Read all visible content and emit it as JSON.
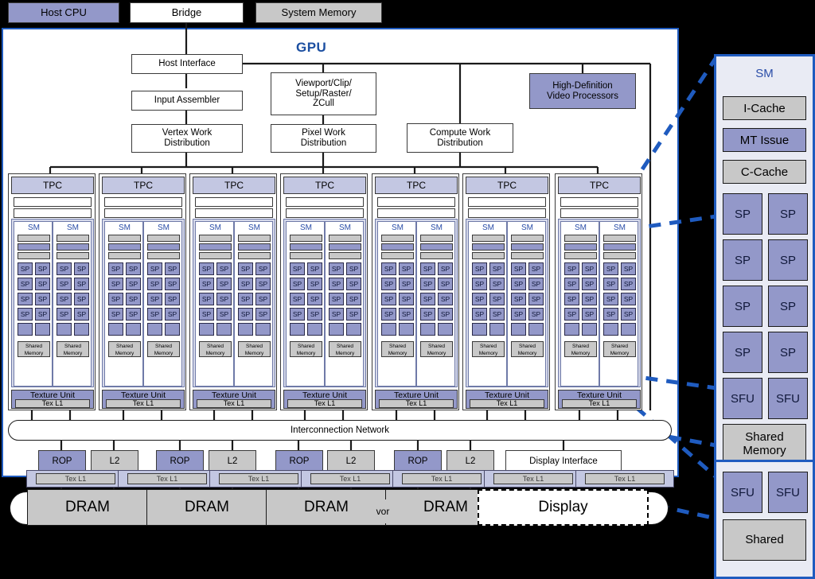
{
  "host": {
    "cpu": "Host CPU",
    "bridge": "Bridge",
    "system_memory": "System Memory"
  },
  "gpu": {
    "title": "GPU",
    "host_interface": "Host Interface",
    "input_assembler": "Input Assembler",
    "viewport_clip": "Viewport/Clip/\nSetup/Raster/\nZCull",
    "viewport_clip_lines": [
      "Viewport/Clip/",
      "Setup/Raster/",
      "ZCull"
    ],
    "hd_video": "High-Definition\nVideo Processors",
    "hd_video_lines": [
      "High-Definition",
      "Video Processors"
    ],
    "vertex_work": "Vertex Work\nDistribution",
    "vertex_work_lines": [
      "Vertex Work",
      "Distribution"
    ],
    "pixel_work": "Pixel Work\nDistribution",
    "pixel_work_lines": [
      "Pixel Work",
      "Distribution"
    ],
    "compute_work": "Compute Work\nDistribution",
    "compute_work_lines": [
      "Compute Work",
      "Distribution"
    ],
    "interconnection_network": "Interconnection Network",
    "display_interface": "Display Interface"
  },
  "tpc": {
    "label": "TPC",
    "count": 7,
    "sm_label": "SM",
    "sm_per_tpc": 2,
    "sp_label": "SP",
    "sp_rows": 4,
    "sp_per_row": 2,
    "shared_memory": "Shared\nMemory",
    "shared_memory_lines": [
      "Shared",
      "Memory"
    ],
    "texture_unit": "Texture Unit",
    "tex_l1": "Tex L1",
    "unlabeled_bars": 2
  },
  "memory_row": {
    "items": [
      {
        "label": "ROP",
        "kind": "rop"
      },
      {
        "label": "L2",
        "kind": "l2"
      },
      {
        "label": "ROP",
        "kind": "rop"
      },
      {
        "label": "L2",
        "kind": "l2"
      },
      {
        "label": "ROP",
        "kind": "rop"
      },
      {
        "label": "L2",
        "kind": "l2"
      },
      {
        "label": "ROP",
        "kind": "rop"
      },
      {
        "label": "L2",
        "kind": "l2"
      },
      {
        "label": "Display Interface",
        "kind": "display-interface"
      }
    ]
  },
  "dram_row": {
    "drams": [
      "DRAM",
      "DRAM",
      "DRAM",
      "DRAM"
    ],
    "display": "Display",
    "ghost_fragment": "vor",
    "ghost_tex_l1": "Tex L1"
  },
  "sm_detail": {
    "title": "SM",
    "i_cache": "I-Cache",
    "mt_issue": "MT Issue",
    "c_cache": "C-Cache",
    "sp": "SP",
    "sfu": "SFU",
    "shared_memory": "Shared\nMemory",
    "shared_memory_lines": [
      "Shared",
      "Memory"
    ],
    "sp_rows": 4,
    "second_panel": {
      "sfu": "SFU",
      "shared": "Shared"
    }
  },
  "colors": {
    "accent_blue": "#1f5bbf",
    "title_blue": "#2a4da8",
    "purple_unit": "#9398c9",
    "lavender_header": "#c3c7e2",
    "gray_cache": "#c8c8c8",
    "panel_bg": "#e9ebf4",
    "background": "#000000",
    "dashed_connector": "#1f5bbf"
  }
}
